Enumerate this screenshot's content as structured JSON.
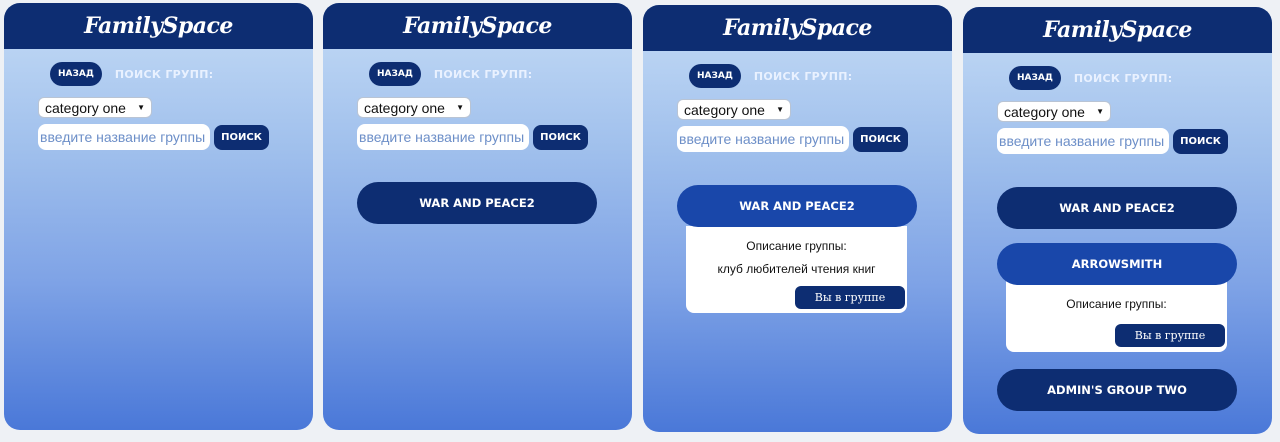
{
  "app": {
    "logo": "FamilySpace"
  },
  "nav": {
    "back_label": "НАЗАД",
    "search_title": "ПОИСК ГРУПП:"
  },
  "filters": {
    "category_selected": "category one",
    "search_placeholder": "введите название группы",
    "search_button": "ПОИСК"
  },
  "groups": [
    {
      "name": "WAR AND PEACE2",
      "description_title": "Описание группы:",
      "description": "клуб любителей чтения книг",
      "membership_button": "Вы в группе"
    },
    {
      "name": "ARROWSMITH",
      "description_title": "Описание группы:",
      "membership_button": "Вы в группе"
    },
    {
      "name": "ADMIN'S GROUP TWO"
    }
  ],
  "colors": {
    "header": "#0d2d72",
    "button": "#0d2d72",
    "active_button": "#1947aa",
    "gradient_top": "#c5dcf6",
    "gradient_bottom": "#4a78d8"
  }
}
